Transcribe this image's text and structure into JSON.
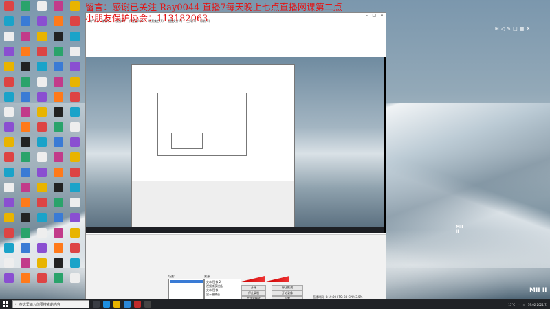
{
  "overlay": {
    "line1": "留言：感谢已关注   Ray0044   直播7每天晚上七点直播网课第二点",
    "line2": "小朋友保护协会：113182063"
  },
  "window": {
    "menu": [
      "文件(F)",
      "编辑(E)",
      "视图(V)",
      "停靠窗口(D)",
      "场景集合(S)",
      "配置文件(P)",
      "工具(T)",
      "帮助(H)"
    ]
  },
  "panels": {
    "scenes_label": "场景:",
    "sources_label": "来源:",
    "sources": [
      "文本/图像 2",
      "视频捕获设备",
      "文本/图像",
      "显示器捕获"
    ],
    "buttons": [
      "开始",
      "停止推流",
      "停止录制",
      "开始录像",
      "工作室模式",
      "设置",
      "退出"
    ],
    "status": "直播时间: 0:19:00  FPS: 30  CPU: 3.5%"
  },
  "badge": "MII II",
  "taskbar": {
    "search_placeholder": "在这里输入你要搜索的内容",
    "temperature": "15°C",
    "time": "19:02",
    "date": "2021/7/"
  },
  "colors": {
    "overlay_text": "#e31414",
    "taskbar": "#202226"
  }
}
